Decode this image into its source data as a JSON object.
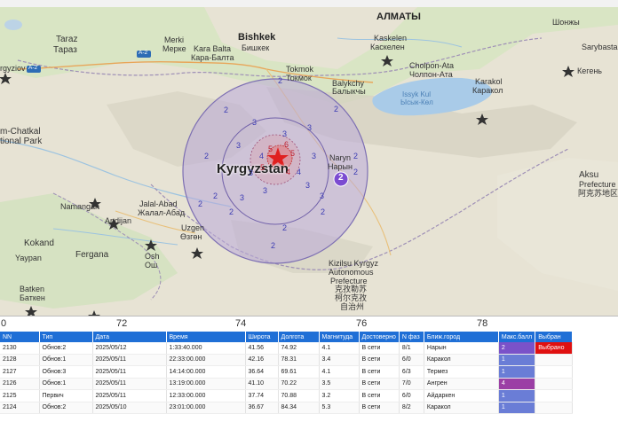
{
  "map": {
    "country_label": "Kyrgyzstan",
    "cities": [
      {
        "id": "almaty",
        "text": "АЛМАТЫ",
        "big": true
      },
      {
        "id": "bishkek-en",
        "text": "Bishkek",
        "big": true
      },
      {
        "id": "bishkek-ru",
        "text": "Бишкек"
      },
      {
        "id": "taraz-en",
        "text": "Taraz"
      },
      {
        "id": "taraz-ru",
        "text": "Тараз"
      },
      {
        "id": "merki-en",
        "text": "Merki"
      },
      {
        "id": "merki-ru",
        "text": "Мерке"
      },
      {
        "id": "karabalta-en",
        "text": "Kara Balta"
      },
      {
        "id": "karabalta-ru",
        "text": "Кара-Балта"
      },
      {
        "id": "tokmok-en",
        "text": "Tokmok"
      },
      {
        "id": "tokmok-ru",
        "text": "Токмок"
      },
      {
        "id": "kaskelen-en",
        "text": "Kaskelen"
      },
      {
        "id": "kaskelen-ru",
        "text": "Каскелен"
      },
      {
        "id": "cholpon-en",
        "text": "Cholpon-Ata"
      },
      {
        "id": "cholpon-ru",
        "text": "Чолпон-Ата"
      },
      {
        "id": "balykchy-en",
        "text": "Balykchy"
      },
      {
        "id": "balykchy-ru",
        "text": "Балыкчы"
      },
      {
        "id": "karakol-en",
        "text": "Karakol"
      },
      {
        "id": "karakol-ru",
        "text": "Каракол"
      },
      {
        "id": "shonzhy",
        "text": "Шонжы"
      },
      {
        "id": "sarybasta",
        "text": "Sarybasta"
      },
      {
        "id": "kegen",
        "text": "Кегень"
      },
      {
        "id": "naryn-en",
        "text": "Naryn"
      },
      {
        "id": "naryn-ru",
        "text": "Нарын"
      },
      {
        "id": "aksu-en",
        "text": "Aksu"
      },
      {
        "id": "aksu-pref",
        "text": "Prefecture"
      },
      {
        "id": "aksu-cn",
        "text": "阿克苏地区"
      },
      {
        "id": "jalalabad-en",
        "text": "Jalal-Abad"
      },
      {
        "id": "jalalabad-ru",
        "text": "Жалал-Абад"
      },
      {
        "id": "namangan",
        "text": "Namangan"
      },
      {
        "id": "andijan",
        "text": "Andijan"
      },
      {
        "id": "uzgen-en",
        "text": "Uzgen"
      },
      {
        "id": "uzgen-ru",
        "text": "Өзгөн"
      },
      {
        "id": "kokand",
        "text": "Kokand"
      },
      {
        "id": "fergana",
        "text": "Fergana"
      },
      {
        "id": "yaypan",
        "text": "Yaypan"
      },
      {
        "id": "osh-en",
        "text": "Osh"
      },
      {
        "id": "osh-ru",
        "text": "Ош"
      },
      {
        "id": "batken-en",
        "text": "Batken"
      },
      {
        "id": "batken-ru",
        "text": "Баткен"
      },
      {
        "id": "kyzylsu-1",
        "text": "Kizilsu Kyrgyz"
      },
      {
        "id": "kyzylsu-2",
        "text": "Autonomous"
      },
      {
        "id": "kyzylsu-3",
        "text": "Prefecture"
      },
      {
        "id": "kyzylsu-4",
        "text": "克孜勒苏"
      },
      {
        "id": "kyzylsu-5",
        "text": "柯尔克孜"
      },
      {
        "id": "kyzylsu-6",
        "text": "自治州"
      },
      {
        "id": "chatkal-1",
        "text": "m-Chatkal"
      },
      {
        "id": "chatkal-2",
        "text": "tional Park"
      },
      {
        "id": "kyrgyziov",
        "text": "rgyziov"
      }
    ],
    "water": [
      {
        "id": "issykkul-en",
        "text": "Issyk Kul"
      },
      {
        "id": "issykkul-ru",
        "text": "Ысык-Көл"
      }
    ],
    "highways": [
      "A-2",
      "A-2"
    ],
    "intensity_labels": [
      "2",
      "2",
      "2",
      "3",
      "3",
      "3",
      "2",
      "2",
      "3",
      "3",
      "4",
      "4",
      "3",
      "3",
      "3",
      "2",
      "2",
      "2",
      "2",
      "2",
      "3",
      "3",
      "2",
      "2"
    ],
    "intensity_red_labels": [
      "5",
      "6",
      "5",
      "5",
      "4"
    ],
    "event_marker_label": "2",
    "colors": {
      "circle_fill": "#b9a9d8",
      "circle_stroke": "#7d6fb3",
      "epicenter": "#e02020",
      "marker": "#7b4bd1"
    }
  },
  "axis_ticks": [
    "0",
    "72",
    "74",
    "76",
    "78"
  ],
  "table": {
    "columns": [
      "NN",
      "Тип",
      "Дата",
      "Время",
      "Широта",
      "Долгота",
      "Магнитуда",
      "Достоверно",
      "N фаз",
      "Ближ.город",
      "Макс.балл",
      "Выбран"
    ],
    "rows": [
      {
        "nn": "2130",
        "type": "Обнов:2",
        "date": "2025/05/12",
        "time": "1:33:40.000",
        "lat": "41.56",
        "lon": "74.92",
        "mag": "4.1",
        "status": "В сети",
        "phases": "8/1",
        "city": "Нарын",
        "max": "2",
        "max_color": "#7a52c9",
        "selected": "Выбрано",
        "selected_color": "#e01010"
      },
      {
        "nn": "2128",
        "type": "Обнов:1",
        "date": "2025/05/11",
        "time": "22:33:00.000",
        "lat": "42.16",
        "lon": "78.31",
        "mag": "3.4",
        "status": "В сети",
        "phases": "6/0",
        "city": "Каракол",
        "max": "1",
        "max_color": "#6a7dd6",
        "selected": "",
        "selected_color": ""
      },
      {
        "nn": "2127",
        "type": "Обнов:3",
        "date": "2025/05/11",
        "time": "14:14:00.000",
        "lat": "36.64",
        "lon": "69.61",
        "mag": "4.1",
        "status": "В сети",
        "phases": "6/3",
        "city": "Термез",
        "max": "1",
        "max_color": "#6a7dd6",
        "selected": "",
        "selected_color": ""
      },
      {
        "nn": "2126",
        "type": "Обнов:1",
        "date": "2025/05/11",
        "time": "13:19:00.000",
        "lat": "41.10",
        "lon": "70.22",
        "mag": "3.5",
        "status": "В сети",
        "phases": "7/0",
        "city": "Ангрен",
        "max": "4",
        "max_color": "#9b3fa5",
        "selected": "",
        "selected_color": ""
      },
      {
        "nn": "2125",
        "type": "Первич",
        "date": "2025/05/11",
        "time": "12:33:00.000",
        "lat": "37.74",
        "lon": "70.88",
        "mag": "3.2",
        "status": "В сети",
        "phases": "6/0",
        "city": "Айдаркен",
        "max": "1",
        "max_color": "#6a7dd6",
        "selected": "",
        "selected_color": ""
      },
      {
        "nn": "2124",
        "type": "Обнов:2",
        "date": "2025/05/10",
        "time": "23:01:00.000",
        "lat": "36.67",
        "lon": "84.34",
        "mag": "5.3",
        "status": "В сети",
        "phases": "8/2",
        "city": "Каракол",
        "max": "1",
        "max_color": "#6a7dd6",
        "selected": "",
        "selected_color": ""
      }
    ]
  }
}
